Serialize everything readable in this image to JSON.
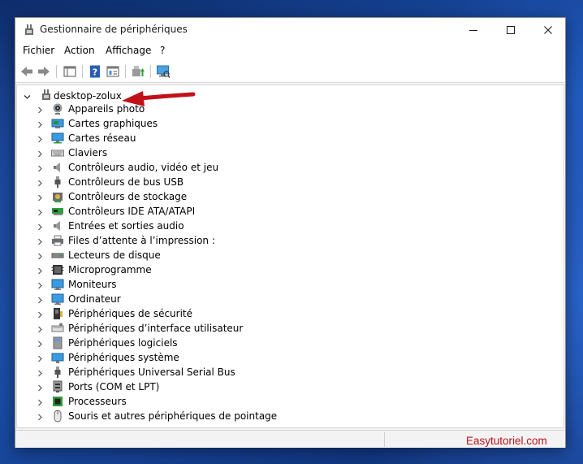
{
  "window": {
    "title": "Gestionnaire de périphériques"
  },
  "menu": [
    {
      "label": "Fichier"
    },
    {
      "label": "Action"
    },
    {
      "label": "Affichage"
    },
    {
      "label": "?"
    }
  ],
  "tree": {
    "root": {
      "label": "desktop-zolux",
      "icon": "computer-icon",
      "expanded": true
    },
    "categories": [
      {
        "label": "Appareils photo",
        "icon": "camera-icon"
      },
      {
        "label": "Cartes graphiques",
        "icon": "display-adapter-icon"
      },
      {
        "label": "Cartes réseau",
        "icon": "network-adapter-icon"
      },
      {
        "label": "Claviers",
        "icon": "keyboard-icon"
      },
      {
        "label": "Contrôleurs audio, vidéo et jeu",
        "icon": "speaker-icon"
      },
      {
        "label": "Contrôleurs de bus USB",
        "icon": "usb-icon"
      },
      {
        "label": "Contrôleurs de stockage",
        "icon": "storage-controller-icon"
      },
      {
        "label": "Contrôleurs IDE ATA/ATAPI",
        "icon": "ide-controller-icon"
      },
      {
        "label": "Entrées et sorties audio",
        "icon": "speaker-icon"
      },
      {
        "label": "Files d’attente à l’impression :",
        "icon": "printer-icon"
      },
      {
        "label": "Lecteurs de disque",
        "icon": "disk-drive-icon"
      },
      {
        "label": "Microprogramme",
        "icon": "firmware-icon"
      },
      {
        "label": "Moniteurs",
        "icon": "monitor-icon"
      },
      {
        "label": "Ordinateur",
        "icon": "monitor-icon"
      },
      {
        "label": "Périphériques de sécurité",
        "icon": "security-device-icon"
      },
      {
        "label": "Périphériques d’interface utilisateur",
        "icon": "hid-icon"
      },
      {
        "label": "Périphériques logiciels",
        "icon": "software-device-icon"
      },
      {
        "label": "Périphériques système",
        "icon": "system-device-icon"
      },
      {
        "label": "Périphériques Universal Serial Bus",
        "icon": "usb-icon"
      },
      {
        "label": "Ports (COM et LPT)",
        "icon": "port-icon"
      },
      {
        "label": "Processeurs",
        "icon": "processor-icon"
      },
      {
        "label": "Souris et autres périphériques de pointage",
        "icon": "mouse-icon"
      }
    ]
  },
  "status": {
    "watermark": "Easytutoriel.com"
  },
  "colors": {
    "annotation_arrow": "#c1121a",
    "watermark": "#b9121b",
    "wallpaper": "#1c55b8"
  }
}
